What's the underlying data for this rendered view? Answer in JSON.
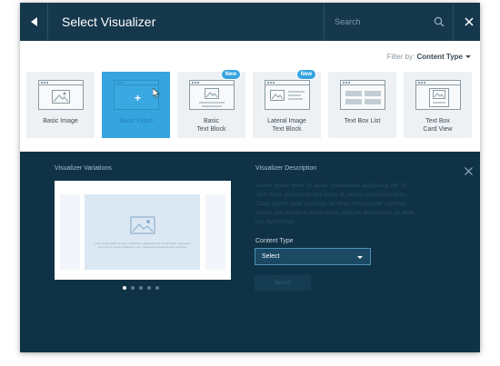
{
  "header": {
    "title": "Select Visualizer",
    "search_placeholder": "Search",
    "back_icon": "triangle-left-icon",
    "search_icon": "magnifier-icon",
    "close_icon": "x-icon",
    "bg_color": "#16384d"
  },
  "filter": {
    "label": "Filter by:",
    "value": "Content Type"
  },
  "visualizers": [
    {
      "label_1": "Basic Image",
      "label_2": "",
      "badge": "",
      "active": false
    },
    {
      "label_1": "Basic Video",
      "label_2": "",
      "badge": "",
      "active": true
    },
    {
      "label_1": "Basic",
      "label_2": "Text Block",
      "badge": "New",
      "active": false
    },
    {
      "label_1": "Lateral Image",
      "label_2": "Text Block",
      "badge": "New",
      "active": false
    },
    {
      "label_1": "Text Box List",
      "label_2": "",
      "badge": "",
      "active": false
    },
    {
      "label_1": "Text Box",
      "label_2": "Card View",
      "badge": "",
      "active": false
    }
  ],
  "details": {
    "variations_title": "Visualizer Variations",
    "preview_text": "Lorem ipsum dolor sit amet, consectetur adipiscing elit. Ut nibh dolor, accumsan nec tortor id, luctus vestibulum eros. Class aptent taciti sociosqu ad litora.",
    "description_title": "Visualizer Description",
    "description_text": "Lorem ipsum dolor sit amet, consectetur adipiscing elit. Ut nibh dolor, accumsan nec tortor id, luctus vestibulum eros. Class aptent taciti sociosqu ad litora torquent per conubia nostra, per inceptos himenaeos. Aliquam fermentum sit amet leo, fermentum",
    "content_type_label": "Content Type",
    "select_value": "Select",
    "select_button": "Select",
    "pagination_total": 5,
    "pagination_active": 1,
    "bg_color": "#103246",
    "accent_color": "#35a4df"
  }
}
